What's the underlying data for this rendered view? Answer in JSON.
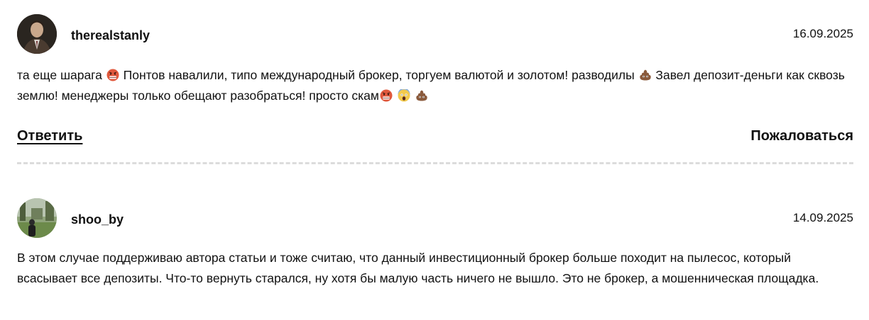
{
  "comments": [
    {
      "username": "therealstanly",
      "date": "16.09.2025",
      "text_parts": [
        "та еще шарага ",
        " Понтов навалили, типо международный брокер, торгуем валютой и золотом! разводилы ",
        " Завел депозит-деньги как сквозь землю! менеджеры только обещают разобраться! просто скам"
      ],
      "emoji_icons": [
        "angry-face-icon",
        "poop-icon",
        "angry-face-icon",
        "screaming-face-icon",
        "poop-icon"
      ]
    },
    {
      "username": "shoo_by",
      "date": "14.09.2025",
      "text": "В этом случае поддерживаю автора статьи и тоже считаю, что данный инвестиционный брокер больше походит на пылесос, который всасывает все депозиты. Что-то вернуть старался, ну хотя бы малую часть ничего не вышло. Это не брокер, а мошенническая площадка."
    }
  ],
  "actions": {
    "reply_label": "Ответить",
    "report_label": "Пожаловаться"
  },
  "colors": {
    "text": "#111111",
    "divider": "#dcdcdc",
    "emoji_angry": "#e0583c",
    "emoji_poop": "#8a5a3c"
  }
}
